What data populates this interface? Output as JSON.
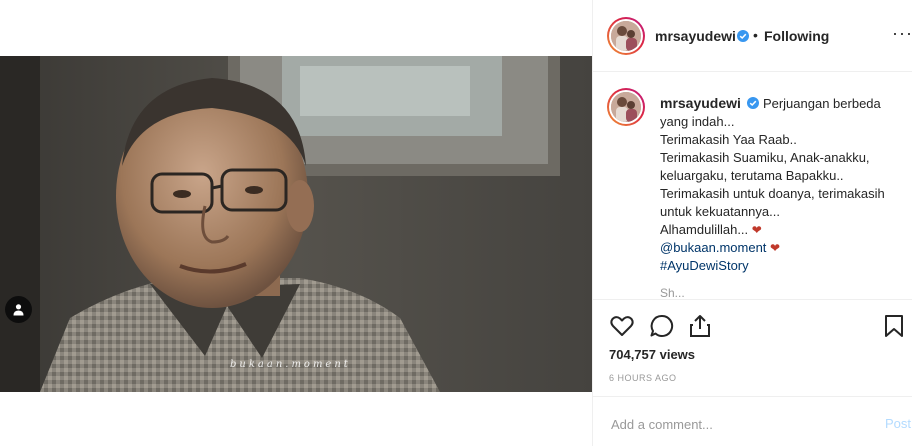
{
  "post": {
    "username": "mrsayudewi",
    "dot": "•",
    "follow_status": "Following",
    "more": "···"
  },
  "media": {
    "watermark": "bukaan.moment",
    "user_tag_icon": "person-icon"
  },
  "caption": {
    "username": "mrsayudewi",
    "lines": [
      "Perjuangan berbeda yang indah...",
      "Terimakasih Yaa Raab..",
      "Terimakasih Suamiku, Anak-anakku, keluargaku, terutama Bapakku..",
      "Terimakasih untuk doanya, terimakasih untuk kekuatannya...",
      "Alhamdulillah..."
    ],
    "mention": "@bukaan.moment",
    "hashtag": "#AyuDewiStory",
    "truncated": "Sh..."
  },
  "actions": {
    "like_icon": "heart-icon",
    "comment_icon": "comment-icon",
    "share_icon": "share-icon",
    "save_icon": "bookmark-icon"
  },
  "stats": {
    "views": "704,757 views",
    "time": "6 HOURS AGO"
  },
  "comment_box": {
    "placeholder": "Add a comment...",
    "post_label": "Post"
  },
  "colors": {
    "verified": "#3897f0",
    "link": "#003569",
    "heart": "#c0392b",
    "post_disabled": "#b3dbff"
  }
}
